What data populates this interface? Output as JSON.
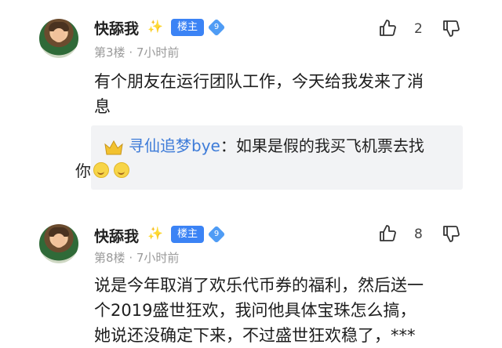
{
  "posts": [
    {
      "username": "快舔我",
      "badge": "楼主",
      "level": "9",
      "floor": "第3楼",
      "time": "7小时前",
      "likes": "2",
      "content_lines": [
        "有个朋友在运行团队工作，今天给我发来了消",
        "息"
      ],
      "reply": {
        "author": "寻仙追梦bye",
        "separator": "：",
        "text_line1": "如果是假的我买飞机票去找",
        "text_line2": "你"
      }
    },
    {
      "username": "快舔我",
      "badge": "楼主",
      "level": "9",
      "floor": "第8楼",
      "time": "7小时前",
      "likes": "8",
      "content_lines": [
        "说是今年取消了欢乐代币券的福利，然后送一",
        "个2019盛世狂欢，我问他具体宝珠怎么搞，",
        "她说还没确定下来，不过盛世狂欢稳了，***"
      ]
    }
  ],
  "meta_separator": "·",
  "colors": {
    "badge": "#3b83f5",
    "link": "#3d7bd8",
    "muted": "#9a9a9a"
  },
  "icons": {
    "like": "thumb-up-icon",
    "dislike": "thumb-down-icon",
    "sparkle": "sparkle-icon",
    "crown": "crown-icon",
    "emoji": "smile-emoji-icon"
  }
}
